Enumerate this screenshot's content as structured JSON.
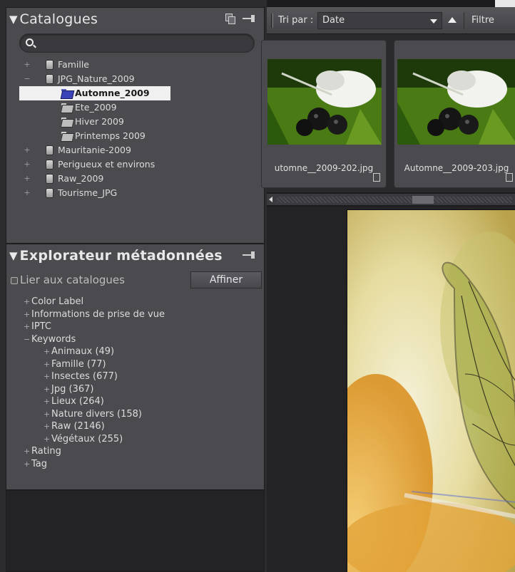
{
  "catalogues": {
    "title": "Catalogues",
    "search_placeholder": "",
    "items": [
      {
        "label": "Famille",
        "level": 0,
        "icon": "database-icon",
        "expander": "+"
      },
      {
        "label": "JPG_Nature_2009",
        "level": 0,
        "icon": "database-icon",
        "expander": "−"
      },
      {
        "label": "Automne_2009",
        "level": 1,
        "icon": "folder-icon",
        "selected": true
      },
      {
        "label": "Ete_2009",
        "level": 1,
        "icon": "folder-icon"
      },
      {
        "label": "Hiver 2009",
        "level": 1,
        "icon": "folder-icon"
      },
      {
        "label": "Printemps 2009",
        "level": 1,
        "icon": "folder-icon"
      },
      {
        "label": "Mauritanie-2009",
        "level": 0,
        "icon": "database-icon",
        "expander": "+"
      },
      {
        "label": "Perigueux et environs",
        "level": 0,
        "icon": "database-icon",
        "expander": "+"
      },
      {
        "label": "Raw_2009",
        "level": 0,
        "icon": "database-icon",
        "expander": "+"
      },
      {
        "label": "Tourisme_JPG",
        "level": 0,
        "icon": "database-icon",
        "expander": "+"
      }
    ]
  },
  "metadata": {
    "title": "Explorateur métadonnées",
    "link_label": "Lier aux catalogues",
    "refine_label": "Affiner",
    "items": [
      {
        "label": "Color Label",
        "level": 0,
        "expander": "+"
      },
      {
        "label": "Informations de prise de vue",
        "level": 0,
        "expander": "+"
      },
      {
        "label": "IPTC",
        "level": 0,
        "expander": "+"
      },
      {
        "label": "Keywords",
        "level": 0,
        "expander": "−"
      },
      {
        "label": "Animaux (49)",
        "level": 1,
        "expander": "+"
      },
      {
        "label": "Famille (77)",
        "level": 1,
        "expander": "+"
      },
      {
        "label": "Insectes (677)",
        "level": 1,
        "expander": "+"
      },
      {
        "label": "Jpg (367)",
        "level": 1,
        "expander": "+"
      },
      {
        "label": "Lieux (264)",
        "level": 1,
        "expander": "+"
      },
      {
        "label": "Nature divers (158)",
        "level": 1,
        "expander": "+"
      },
      {
        "label": "Raw (2146)",
        "level": 1,
        "expander": "+"
      },
      {
        "label": "Végétaux (255)",
        "level": 1,
        "expander": "+"
      },
      {
        "label": "Rating",
        "level": 0,
        "expander": "+"
      },
      {
        "label": "Tag",
        "level": 0,
        "expander": "+"
      }
    ]
  },
  "toolbar": {
    "sort_label": "Tri par :",
    "sort_value": "Date",
    "filter_label": "Filtre"
  },
  "thumbnails": [
    {
      "caption": "utomne__2009-202.jpg"
    },
    {
      "caption": "Automne__2009-203.jpg"
    }
  ],
  "colors": {
    "panel_bg": "#4a4a4f",
    "selection_bg": "#f0f0f0",
    "folder_selected": "#3a44b8"
  }
}
